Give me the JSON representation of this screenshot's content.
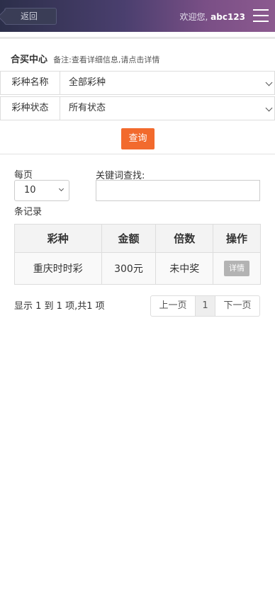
{
  "header": {
    "back_label": "返回",
    "welcome_text": "欢迎您,",
    "username": "abc123",
    "menu_icon": "hamburger-menu-icon"
  },
  "page": {
    "title": "合买中心",
    "note": "备注:查看详细信息,请点击详情"
  },
  "filters": {
    "lottery_name_label": "彩种名称",
    "lottery_name_value": "全部彩种",
    "lottery_status_label": "彩种状态",
    "lottery_status_value": "所有状态",
    "query_label": "查询"
  },
  "list_controls": {
    "per_page_label": "每页",
    "per_page_value": "10",
    "records_label": "条记录",
    "search_label": "关键词查找:",
    "search_value": ""
  },
  "table": {
    "columns": [
      "彩种",
      "金额",
      "倍数",
      "操作"
    ],
    "rows": [
      {
        "lottery": "重庆时时彩",
        "amount": "300元",
        "multiple": "未中奖",
        "action": "详情"
      }
    ]
  },
  "pagination": {
    "summary": "显示 1 到 1 项,共1 项",
    "prev": "上一页",
    "current": "1",
    "next": "下一页"
  },
  "colors": {
    "accent": "#f26a2d",
    "header_gradient_start": "#2c2f4a",
    "header_gradient_end": "#8c5a8f"
  }
}
